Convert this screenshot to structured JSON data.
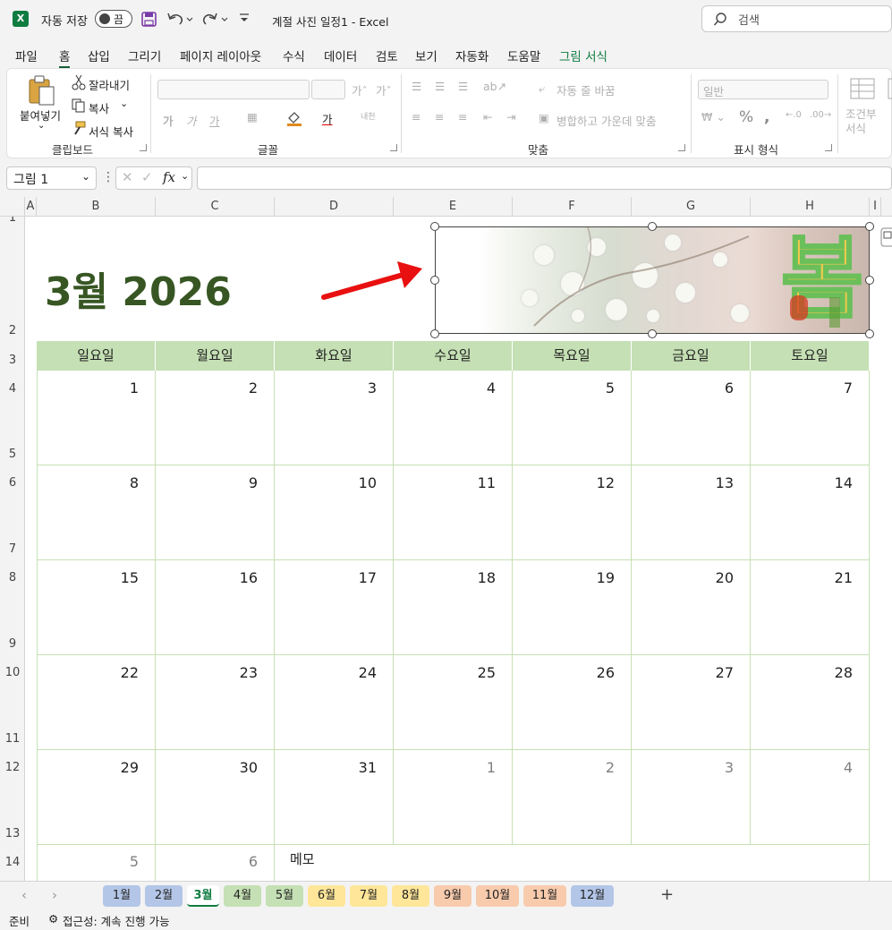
{
  "titlebar": {
    "autosave_label": "자동 저장",
    "autosave_state": "끔",
    "doc_title": "계절 사진 일정1 - Excel",
    "search_placeholder": "검색"
  },
  "menu": [
    "파일",
    "홈",
    "삽입",
    "그리기",
    "페이지 레이아웃",
    "수식",
    "데이터",
    "검토",
    "보기",
    "자동화",
    "도움말",
    "그림 서식"
  ],
  "ribbon": {
    "clipboard": {
      "paste": "붙여넣기",
      "cut": "잘라내기",
      "copy": "복사",
      "format_painter": "서식 복사",
      "label": "클립보드"
    },
    "font": {
      "label": "글꼴"
    },
    "align": {
      "wrap": "자동 줄 바꿈",
      "merge": "병합하고 가운데 맞춤",
      "label": "맞춤"
    },
    "number": {
      "format": "일반",
      "label": "표시 형식"
    },
    "styles": {
      "conditional_1": "조건부",
      "conditional_2": "서식"
    }
  },
  "formula_bar": {
    "name_box": "그림 1",
    "fx": "fx",
    "formula": ""
  },
  "columns": [
    "A",
    "B",
    "C",
    "D",
    "E",
    "F",
    "G",
    "H",
    "I"
  ],
  "rows": [
    "1",
    "2",
    "3",
    "4",
    "5",
    "6",
    "7",
    "8",
    "9",
    "10",
    "11",
    "12",
    "13",
    "14"
  ],
  "calendar": {
    "title": "3월 2026",
    "days": [
      "일요일",
      "월요일",
      "화요일",
      "수요일",
      "목요일",
      "금요일",
      "토요일"
    ],
    "weeks": [
      [
        "1",
        "2",
        "3",
        "4",
        "5",
        "6",
        "7"
      ],
      [
        "8",
        "9",
        "10",
        "11",
        "12",
        "13",
        "14"
      ],
      [
        "15",
        "16",
        "17",
        "18",
        "19",
        "20",
        "21"
      ],
      [
        "22",
        "23",
        "24",
        "25",
        "26",
        "27",
        "28"
      ],
      [
        "29",
        "30",
        "31",
        "1",
        "2",
        "3",
        "4"
      ]
    ],
    "last_row": [
      "5",
      "6"
    ],
    "memo": "메모",
    "picture_text": "봄"
  },
  "tabs": [
    {
      "label": "1월",
      "color": "#b4c6e7"
    },
    {
      "label": "2월",
      "color": "#b4c6e7"
    },
    {
      "label": "3월",
      "color": "#ffffff"
    },
    {
      "label": "4월",
      "color": "#c5e0b4"
    },
    {
      "label": "5월",
      "color": "#c5e0b4"
    },
    {
      "label": "6월",
      "color": "#ffe699"
    },
    {
      "label": "7월",
      "color": "#ffe699"
    },
    {
      "label": "8월",
      "color": "#ffe699"
    },
    {
      "label": "9월",
      "color": "#f8cbad"
    },
    {
      "label": "10월",
      "color": "#f8cbad"
    },
    {
      "label": "11월",
      "color": "#f8cbad"
    },
    {
      "label": "12월",
      "color": "#b4c6e7"
    }
  ],
  "status": {
    "ready": "준비",
    "accessibility": "접근성: 계속 진행 가능"
  },
  "colors": {
    "header_green": "#c5e0b4",
    "title_green": "#375623",
    "excel_green": "#107c41",
    "arrow_red": "#e81010"
  }
}
